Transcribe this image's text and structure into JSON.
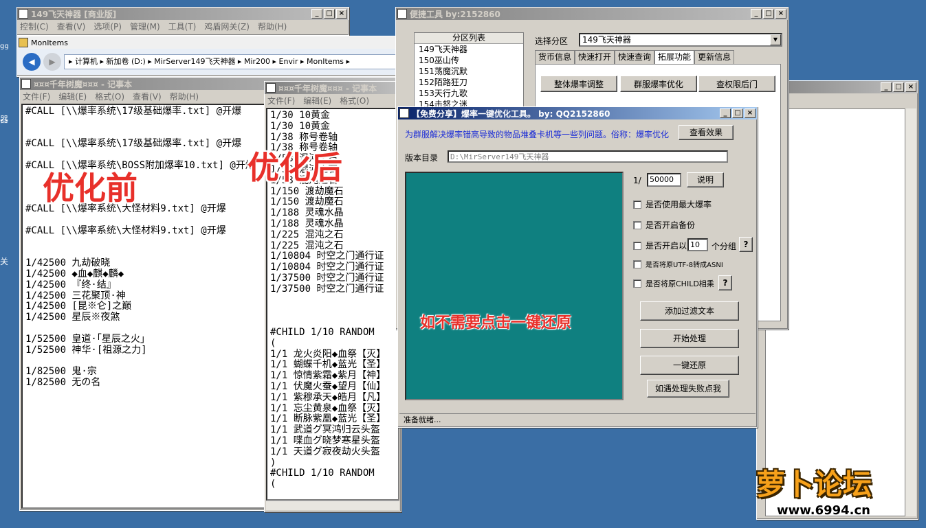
{
  "desktop": {
    "edge_left_1": "gg",
    "edge_left_2": "器",
    "edge_left_3": "关"
  },
  "win_main": {
    "title": "149飞天神器 [商业版]",
    "menu": [
      "控制(C)",
      "查看(V)",
      "选项(P)",
      "管理(M)",
      "工具(T)",
      "鸡盾网关(Z)",
      "帮助(H)"
    ]
  },
  "explorer": {
    "title": "MonItems",
    "path": "▸ 计算机 ▸ 新加卷 (D:) ▸ MirServer149飞天神器 ▸ Mir200 ▸ Envir ▸ MonItems ▸"
  },
  "notepad_left": {
    "title": "¤¤¤千年树魔¤¤¤ - 记事本",
    "menu": [
      "文件(F)",
      "编辑(E)",
      "格式(O)",
      "查看(V)",
      "帮助(H)"
    ],
    "text": "#CALL [\\\\爆率系统\\17级基础爆率.txt] @开爆\n\n\n#CALL [\\\\爆率系统\\17级基础爆率.txt] @开爆\n\n#CALL [\\\\爆率系统\\BOSS附加爆率10.txt] @开爆\n\n\n\n#CALL [\\\\爆率系统\\大怪材料9.txt] @开爆\n\n#CALL [\\\\爆率系统\\大怪材料9.txt] @开爆\n\n\n1/42500 九劫破晓\n1/42500 ◆血◆麒◆麟◆\n1/42500 『终·结』\n1/42500 三花聚顶·神\n1/42500 [昆※仑]之巅\n1/42500 星辰※夜煞\n\n1/52500 皇道·「星辰之火」\n1/52500 神华·[祖源之力]\n\n1/82500 鬼·宗\n1/82500 无の名"
  },
  "notepad_right": {
    "title": "¤¤¤千年树魔¤¤¤ - 记事本",
    "menu": [
      "文件(F)",
      "编辑(E)",
      "格式(O)"
    ],
    "text": "1/30 10黄金\n1/30 10黄金\n1/38 称号卷轴\n1/38 称号卷轴\n1/58 混沌之石\n1/58 混沌之石\n1/58 混沌之石\n1/150 渡劫魔石\n1/150 渡劫魔石\n1/188 灵魂水晶\n1/188 灵魂水晶\n1/225 混沌之石\n1/225 混沌之石\n1/10804 时空之门通行证\n1/10804 时空之门通行证\n1/37500 时空之门通行证\n1/37500 时空之门通行证\n\n\n\n#CHILD 1/10 RANDOM\n(\n1/1 龙火炎阳◆血祭【灭】\n1/1 蝴蝶千机◆蓝光【圣】\n1/1 惊情紫霜◆紫月【神】\n1/1 伏魔火蚕◆望月【仙】\n1/1 紫穆承天◆皓月【凡】\n1/1 忘尘黄泉◆血祭【灭】\n1/1 断脉紫凰◆蓝光【圣】\n1/1 武道グ冥鸿归云头盔\n1/1 喋血グ晓梦寒星头盔\n1/1 天道グ寂夜劫火头盔\n)\n#CHILD 1/10 RANDOM\n("
  },
  "labels": {
    "before": "优化前",
    "after": "优化后"
  },
  "tools": {
    "title": "便捷工具   by:2152860",
    "list_header": "分区列表",
    "list_items": [
      "149飞天神器",
      "150巫山传",
      "151荡魔沉默",
      "152陌路狂刀",
      "153天行九歌",
      "154击怒之迷"
    ],
    "select_label": "选择分区",
    "select_value": "149飞天神器",
    "tabs": [
      "货币信息",
      "快速打开",
      "快速查询",
      "拓展功能",
      "更新信息"
    ],
    "buttons": [
      "整体爆率调整",
      "群服爆率优化",
      "查权限后门"
    ]
  },
  "optimizer": {
    "title": "【免费分享】爆率一键优化工具。   by: QQ2152860",
    "desc": "为群服解决爆率错高导致的物品堆叠卡机等一些列问题。俗称：爆率优化",
    "view_effect": "查看效果",
    "dir_label": "版本目录",
    "dir_value": "D:\\MirServer149飞天神器",
    "ratio_prefix": "1/",
    "ratio_value": "50000",
    "explain": "说明",
    "chk_max": "是否使用最大爆率",
    "chk_backup": "是否开启备份",
    "chk_group_pre": "是否开启以",
    "group_value": "10",
    "chk_group_post": "个分组",
    "chk_utf8": "是否将原UTF-8转成ASNI",
    "chk_child": "是否将原CHILD相乘",
    "q": "?",
    "btn_filter": "添加过滤文本",
    "btn_start": "开始处理",
    "btn_restore": "一键还原",
    "btn_fail": "如遇处理失败点我",
    "overlay": "如不需要点击一键还原",
    "status": "准备就绪..."
  },
  "watermark": {
    "logo": "萝卜论坛",
    "url": "www.6994.cn"
  }
}
